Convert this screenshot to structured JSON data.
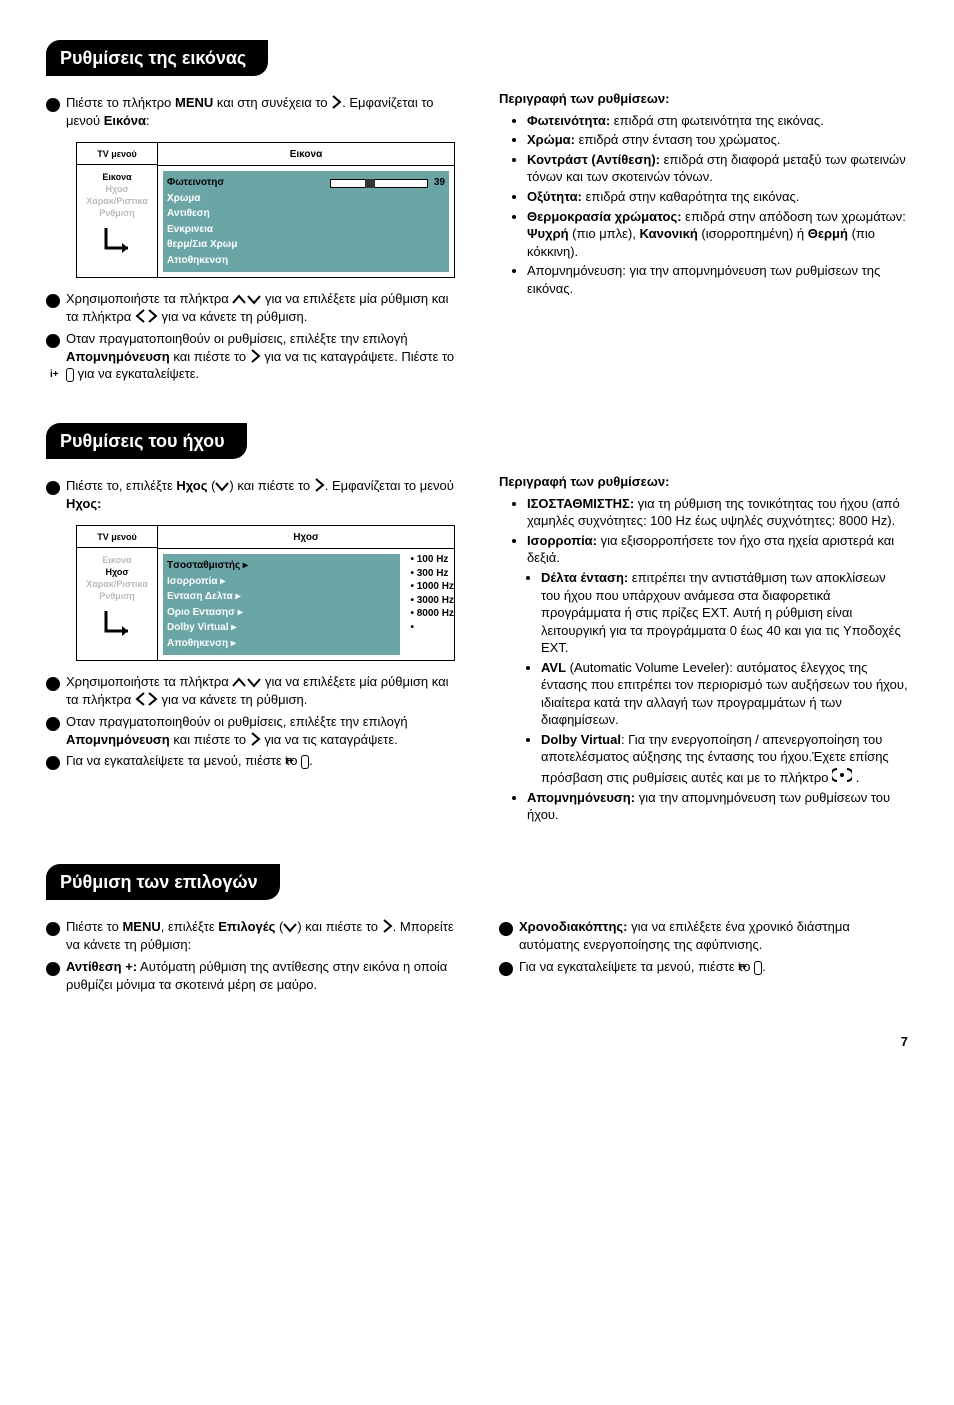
{
  "s1": {
    "head": "Ρυθμίσεις της εικόνας",
    "step1a": "Πιέστε το πλήκτρο ",
    "step1b": "MENU",
    "step1c": " και στη συνέχεια το ",
    "step1d": ". Εμφανίζεται το μενού ",
    "step1e": "Εικόνα",
    "step1f": ":",
    "step2a": "Χρησιμοποιήστε τα πλήκτρα ",
    "step2b": " για να επιλέξετε μία ρύθμιση και τα πλήκτρα ",
    "step2c": " για να κάνετε τη ρύθμιση.",
    "step3a": "Οταν πραγματοποιηθούν οι ρυθμίσεις, επιλέξτε την επιλογή ",
    "step3b": "Απομνημόνευση",
    "step3c": " και πιέστε το ",
    "step3d": " για να τις καταγράψετε. Πιέστε το ",
    "step3e": " για να εγκαταλείψετε.",
    "rhead": "Περιγραφή των ρυθμίσεων:",
    "r1b": "Φωτεινότητα:",
    "r1": " επιδρά στη φωτεινότητα της εικόνας.",
    "r2b": "Χρώμα:",
    "r2": " επιδρά στην ένταση του χρώματος.",
    "r3b": "Κοντράστ (Αντίθεση):",
    "r3": " επιδρά στη διαφορά μεταξύ των φωτεινών τόνων και των σκοτεινών τόνων.",
    "r4b": "Οξύτητα:",
    "r4": " επιδρά στην καθαρότητα της εικόνας.",
    "r5b": "Θερμοκρασία χρώματος:",
    "r5a": " επιδρά στην απόδοση των χρωμάτων: ",
    "r5c": "Ψυχρή",
    "r5d": " (πιο μπλε), ",
    "r5e": "Κανονική",
    "r5f": " (ισορροπημένη) ή ",
    "r5g": "Θερμή",
    "r5h": " (πιο κόκκινη).",
    "r6": "Απομνημόνευση: για την απομνημόνευση των ρυθμίσεων της εικόνας.",
    "fig": {
      "leftHdr": "TV μενού",
      "leftItems": [
        "Εικονα",
        "Hχοσ",
        "Χαρακ/Ριστικα",
        "Ρνθμιση"
      ],
      "rightHdr": "Εικονα",
      "rows": [
        "Φωτεινοτησ",
        "Χρωμα",
        "Αντιθεση",
        "Ενκρινεια",
        "θερμ/Σια Χρωμ",
        "Αποθηκενση"
      ],
      "val": "39"
    }
  },
  "s2": {
    "head": "Ρυθμίσεις του ήχου",
    "step1a": "Πιέστε το, επιλέξτε ",
    "step1b": "Hχος",
    "step1c": " (",
    "step1d": ") και πιέστε το ",
    "step1e": ". Εμφανίζεται το μενού ",
    "step1f": "Hχος:",
    "step2a": "Χρησιμοποιήστε τα πλήκτρα ",
    "step2b": " για να επιλέξετε μία ρύθμιση και τα πλήκτρα ",
    "step2c": " για να κάνετε τη ρύθμιση.",
    "step3a": "Οταν πραγματοποιηθούν οι ρυθμίσεις, επιλέξτε την επιλογή ",
    "step3b": "Απομνημόνευση",
    "step3c": " και πιέστε το ",
    "step3d": " για να τις καταγράψετε.",
    "step4a": "Για να εγκαταλείψετε τα μενού, πιέστε το ",
    "step4b": ".",
    "rhead": "Περιγραφή των ρυθμίσεων:",
    "r1b": "ΙΣΟΣΤΑΘΜΙΣΤΗΣ:",
    "r1": " για τη ρύθμιση της τονικότητας του ήχου (από χαμηλές συχνότητες: 100 Hz έως υψηλές συχνότητες: 8000 Hz).",
    "r2b": "Ισορροπία:",
    "r2": " για εξισορροπήσετε τον ήχο στα ηχεία αριστερά και δεξιά.",
    "r2s1b": "Dέλτα ένταση:",
    "r2s1": " επιτρέπει την αντιστάθμιση των αποκλίσεων του ήχου που υπάρχουν ανάμεσα στα διαφορετικά προγράμματα ή στις πρίζες EXT. Αυτή η ρύθμιση είναι λειτουργική για τα προγράμματα 0 έως 40 και για τις Υποδοχές EXT.",
    "r2s2b": "AVL",
    "r2s2": " (Automatic Volume Leveler): αυτόματος έλεγχος της έντασης που επιτρέπει τον περιορισμό των αυξήσεων του ήχου, ιδιαίτερα κατά την αλλαγή των προγραμμάτων ή των διαφημίσεων.",
    "r2s3b": "Dolby Virtual",
    "r2s3a": ": Για την ενεργοποίηση / απενεργοποίηση του αποτελέσματος αύξησης της έντασης του ήχου.Έχετε επίσης πρόσβαση στις ρυθμίσεις αυτές και με το πλήκτρο ",
    "r2s3c": " .",
    "r3b": "Απομνημόνευση:",
    "r3": " για την απομνημόνευση των ρυθμίσεων του ήχου.",
    "fig": {
      "leftHdr": "TV μενού",
      "leftItems": [
        "Εικονα",
        "Hχοσ",
        "Χαρακ/Ριστικα",
        "Ρνθμιση"
      ],
      "rightHdr": "Hχοσ",
      "rows": [
        "Tσοσταθμιστής ▸",
        "Ισορροπία ▸",
        "Ενταση Δελτα ▸",
        "Οριο Εντασησ ▸",
        "Dolby Virtual ▸",
        "Αποθηκενση ▸"
      ],
      "vals": [
        "100 Hz",
        "300 Hz",
        "1000 Hz",
        "3000 Hz",
        "8000 Hz"
      ]
    }
  },
  "s3": {
    "head": "Ρύθμιση των επιλογών",
    "step1a": "Πιέστε το ",
    "step1b": "MENU",
    "step1c": ", επιλέξτε ",
    "step1d": "Επιλογές",
    "step1e": " (",
    "step1f": ") και πιέστε το ",
    "step1g": ". Μπορείτε να κάνετε τη ρύθμιση:",
    "step2a": "Αντίθεση +:",
    "step2b": " Αυτόματη ρύθμιση της αντίθεσης στην εικόνα η οποία ρυθμίζει μόνιμα τα σκοτεινά μέρη σε μαύρο.",
    "step3a": "Χρονοδιακόπτης:",
    "step3b": " για να επιλέξετε ένα χρονικό διάστημα αυτόματης ενεργοποίησης της αφύπνισης.",
    "step4a": "Για να εγκαταλείψετε τα μενού, πιέστε το ",
    "step4b": "."
  },
  "ibtn": "i+",
  "pgnum": "7"
}
